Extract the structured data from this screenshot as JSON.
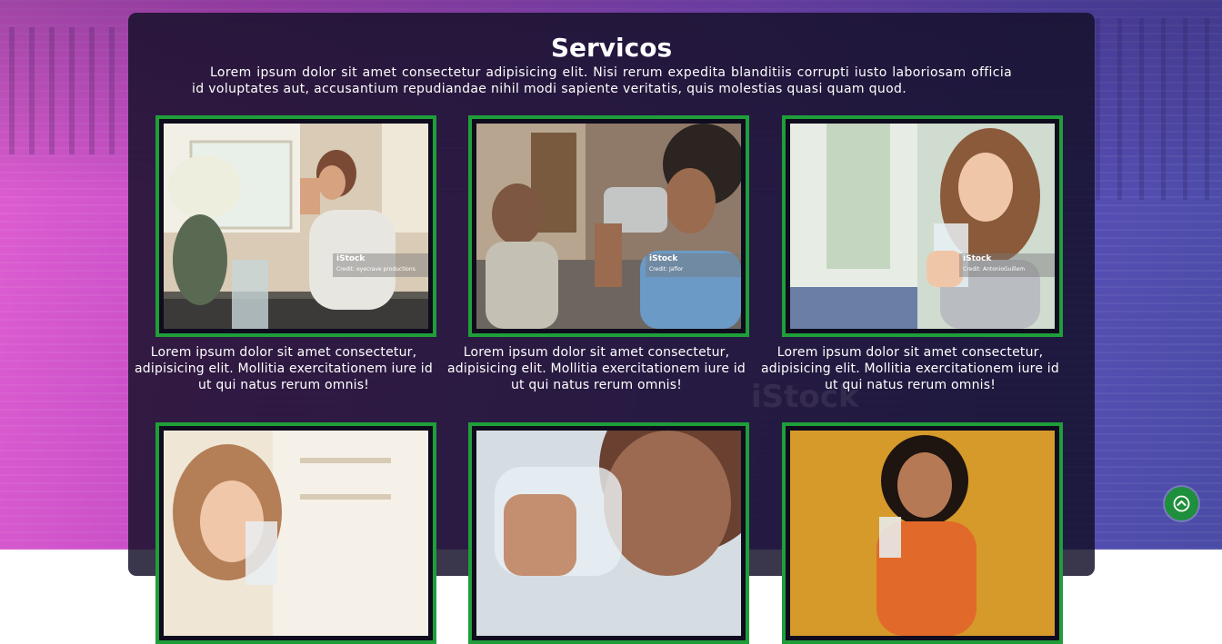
{
  "section": {
    "title": "Servicos",
    "intro": "Lorem ipsum dolor sit amet consectetur adipisicing elit. Nisi rerum expedita blanditiis corrupti iusto laboriosam officia id voluptates aut, accusantium repudiandae nihil modi sapiente veritatis, quis molestias quasi quam quod."
  },
  "cards": [
    {
      "caption": "Lorem ipsum dolor sit amet consectetur, adipisicing elit. Mollitia exercitationem iure id ut qui natus rerum omnis!",
      "watermark_brand": "iStock",
      "watermark_credit": "Credit: eyecrave productions"
    },
    {
      "caption": "Lorem ipsum dolor sit amet consectetur, adipisicing elit. Mollitia exercitationem iure id ut qui natus rerum omnis!",
      "watermark_brand": "iStock",
      "watermark_credit": "Credit: Jaflor"
    },
    {
      "caption": "Lorem ipsum dolor sit amet consectetur, adipisicing elit. Mollitia exercitationem iure id ut qui natus rerum omnis!",
      "watermark_brand": "iStock",
      "watermark_credit": "Credit: AntonioGuillem"
    },
    {
      "caption": ""
    },
    {
      "caption": ""
    },
    {
      "caption": ""
    }
  ],
  "background_watermark": "iStock",
  "colors": {
    "frame_border": "#1f9e3a",
    "panel": "rgba(20,16,40,0.84)",
    "scroll_button": "#1e8f3c"
  },
  "icons": {
    "scroll_top": "chevron-up-circle-icon"
  }
}
